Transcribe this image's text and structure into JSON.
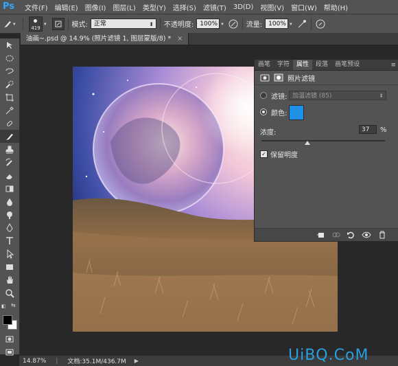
{
  "app": {
    "logo": "Ps"
  },
  "menu": [
    "文件(F)",
    "编辑(E)",
    "图像(I)",
    "图层(L)",
    "类型(Y)",
    "选择(S)",
    "滤镜(T)",
    "3D(D)",
    "视图(V)",
    "窗口(W)",
    "帮助(H)"
  ],
  "options": {
    "brush_size": "419",
    "mode_label": "模式:",
    "mode_value": "正常",
    "opacity_label": "不透明度:",
    "opacity_value": "100%",
    "flow_label": "流量:",
    "flow_value": "100%"
  },
  "document": {
    "tab_title": "油画~.psd @ 14.9% (照片滤镜 1, 图层蒙版/8) *",
    "close": "×"
  },
  "panel": {
    "tabs": [
      "画笔",
      "字符",
      "属性",
      "段落",
      "画笔预设"
    ],
    "active_tab": "属性",
    "title": "照片滤镜",
    "filter_label": "滤镜:",
    "filter_value": "加温滤镜 (85)",
    "color_label": "颜色:",
    "color_value": "#1e90e6",
    "density_label": "浓度:",
    "density_value": "37",
    "density_unit": "%",
    "density_fraction": 0.37,
    "preserve_label": "保留明度",
    "preserve_checked": true
  },
  "status": {
    "zoom": "14.87%",
    "doc_info": "文档:35.1M/436.7M"
  },
  "watermark": "UiBQ.CoM",
  "colors": {
    "foreground": "#000000",
    "background": "#ffffff",
    "accent": "#31a8ff"
  }
}
